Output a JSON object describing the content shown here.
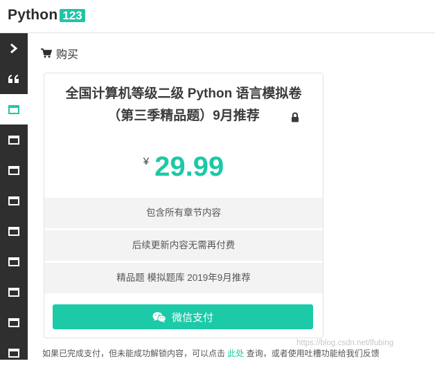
{
  "brand": {
    "name": "Python",
    "badge": "123",
    "accent": "#1fc5a7"
  },
  "sidebar": {
    "items": [
      {
        "icon": "chevron-right-icon",
        "active": false
      },
      {
        "icon": "quote-icon",
        "active": false
      },
      {
        "icon": "window-icon",
        "active": true
      },
      {
        "icon": "window-icon",
        "active": false
      },
      {
        "icon": "window-icon",
        "active": false
      },
      {
        "icon": "window-icon",
        "active": false
      },
      {
        "icon": "window-icon",
        "active": false
      },
      {
        "icon": "window-icon",
        "active": false
      },
      {
        "icon": "window-icon",
        "active": false
      },
      {
        "icon": "window-icon",
        "active": false
      }
    ]
  },
  "section": {
    "icon": "cart-icon",
    "title": "购买"
  },
  "product": {
    "title_line1": "全国计算机等级二级 Python 语言模拟卷",
    "title_line2": "（第三季精品题）9月推荐",
    "lock_icon": "lock-icon",
    "currency": "¥",
    "price": "29.99",
    "features": [
      "包含所有章节内容",
      "后续更新内容无需再付费",
      "精品题 模拟题库 2019年9月推荐"
    ],
    "pay_button": {
      "icon": "wechat-icon",
      "label": "微信支付"
    }
  },
  "note": {
    "before": "如果已完成支付，但未能成功解锁内容，可以点击 ",
    "link": "此处",
    "after": " 查询，或者使用吐槽功能给我们反馈"
  },
  "watermark": "https://blog.csdn.net/lfubing"
}
